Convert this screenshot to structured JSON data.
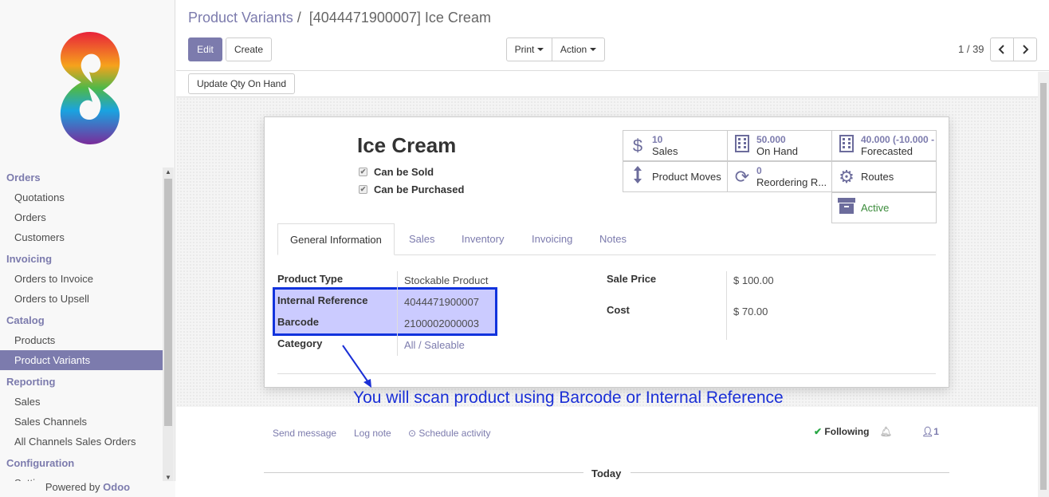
{
  "breadcrumb": {
    "parent": "Product Variants",
    "separator": "/",
    "current": "[4044471900007] Ice Cream"
  },
  "buttons": {
    "edit": "Edit",
    "create": "Create",
    "print": "Print",
    "action": "Action",
    "update_qty": "Update Qty On Hand"
  },
  "pager": {
    "value": "1 / 39"
  },
  "sidebar": {
    "sections": [
      {
        "title": "Orders",
        "items": [
          "Quotations",
          "Orders",
          "Customers"
        ]
      },
      {
        "title": "Invoicing",
        "items": [
          "Orders to Invoice",
          "Orders to Upsell"
        ]
      },
      {
        "title": "Catalog",
        "items": [
          "Products",
          "Product Variants"
        ]
      },
      {
        "title": "Reporting",
        "items": [
          "Sales",
          "Sales Channels",
          "All Channels Sales Orders"
        ]
      },
      {
        "title": "Configuration",
        "items": [
          "Settings"
        ]
      }
    ],
    "active_item": "Product Variants",
    "powered_prefix": "Powered by ",
    "powered_brand": "Odoo"
  },
  "product": {
    "name": "Ice Cream",
    "can_be_sold": "Can be Sold",
    "can_be_purchased": "Can be Purchased"
  },
  "smart_buttons": {
    "sales": {
      "value": "10",
      "label": "Sales",
      "icon": "dollar-icon"
    },
    "on_hand": {
      "value": "50.000",
      "label": "On Hand",
      "icon": "building-icon"
    },
    "forecasted": {
      "value": "40.000 (-10.000 -",
      "label": "Forecasted",
      "icon": "building-icon"
    },
    "moves": {
      "label": "Product Moves",
      "icon": "arrows-vertical-icon"
    },
    "reordering": {
      "value": "0",
      "label": "Reordering R...",
      "icon": "refresh-icon"
    },
    "routes": {
      "label": "Routes",
      "icon": "cogs-icon"
    },
    "active": {
      "label": "Active",
      "icon": "archive-icon"
    }
  },
  "tabs": [
    "General Information",
    "Sales",
    "Inventory",
    "Invoicing",
    "Notes"
  ],
  "fields": {
    "product_type": {
      "label": "Product Type",
      "value": "Stockable Product"
    },
    "internal_reference": {
      "label": "Internal Reference",
      "value": "4044471900007"
    },
    "barcode": {
      "label": "Barcode",
      "value": "2100002000003"
    },
    "category": {
      "label": "Category",
      "value": "All / Saleable"
    },
    "sale_price": {
      "label": "Sale Price",
      "value": "$ 100.00"
    },
    "cost": {
      "label": "Cost",
      "value": "$ 70.00"
    }
  },
  "annotation": "You will scan product using Barcode or Internal Reference",
  "chatter": {
    "send_message": "Send message",
    "log_note": "Log note",
    "schedule_activity": "Schedule activity",
    "following": "Following",
    "followers": "1",
    "today": "Today"
  },
  "colors": {
    "accent": "#7c7bad",
    "annotation": "#1a2fd6",
    "active_green": "#3c8c3c"
  }
}
